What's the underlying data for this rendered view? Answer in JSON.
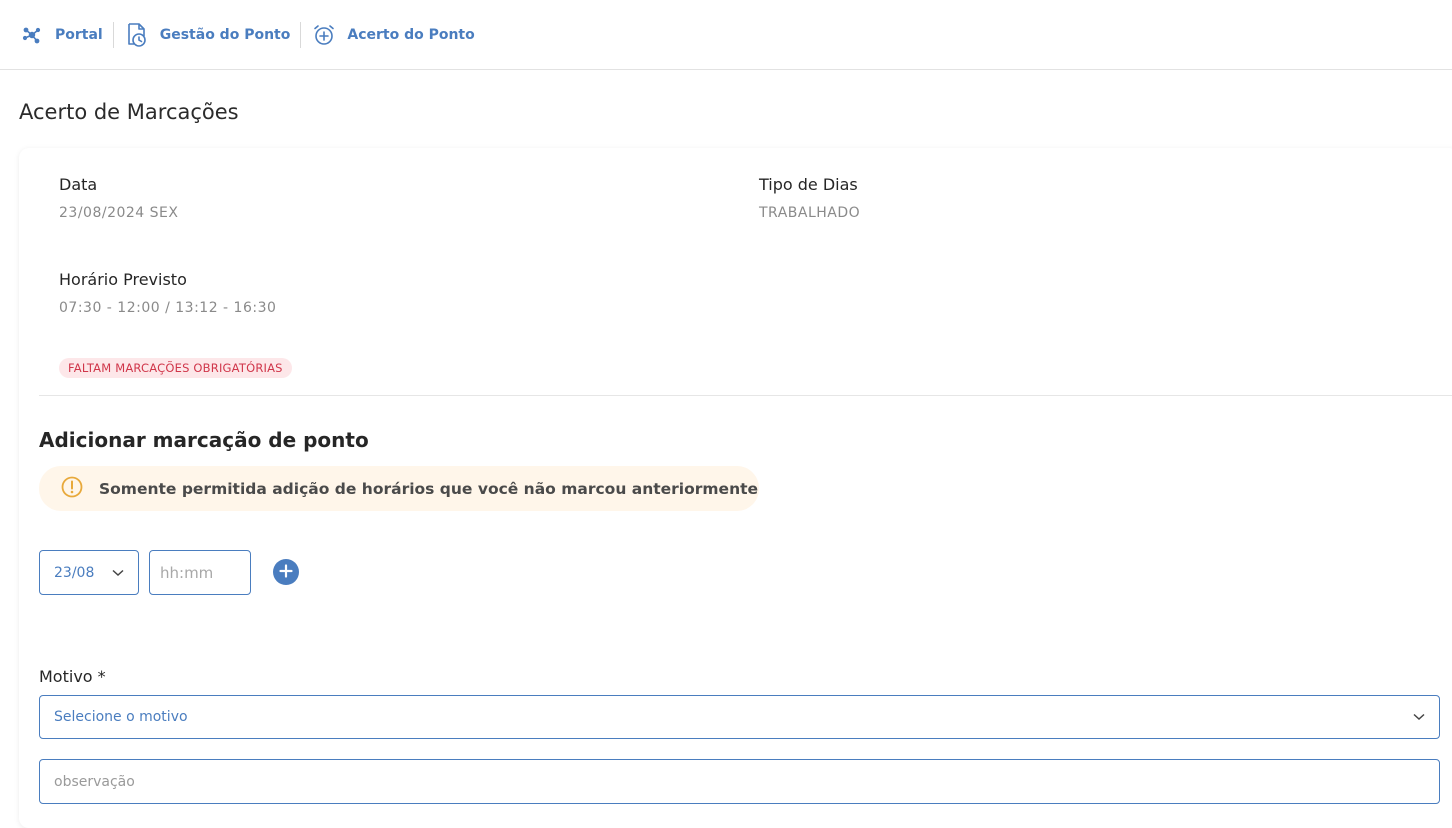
{
  "breadcrumb": {
    "items": [
      {
        "label": "Portal",
        "icon": "portal-network-icon"
      },
      {
        "label": "Gestão do Ponto",
        "icon": "document-clock-icon"
      },
      {
        "label": "Acerto do Ponto",
        "icon": "alarm-plus-icon"
      }
    ]
  },
  "page": {
    "title": "Acerto de Marcações"
  },
  "details": {
    "data_label": "Data",
    "data_value": "23/08/2024 SEX",
    "tipo_label": "Tipo de Dias",
    "tipo_value": "TRABALHADO",
    "horario_label": "Horário Previsto",
    "horario_value": "07:30 - 12:00 / 13:12 - 16:30",
    "status_badge": "FALTAM MARCAÇÕES OBRIGATÓRIAS"
  },
  "add_section": {
    "title": "Adicionar marcação de ponto",
    "warning": "Somente permitida adição de horários que você não marcou anteriormente",
    "date_selected": "23/08",
    "time_placeholder": "hh:mm"
  },
  "motivo": {
    "label": "Motivo *",
    "select_placeholder": "Selecione o motivo",
    "obs_placeholder": "observação"
  },
  "colors": {
    "accent": "#4a7dbf",
    "badge_bg": "#fde7e9",
    "badge_text": "#d0364a",
    "warning_bg": "#fff6ea",
    "warning_icon": "#e8a93b"
  }
}
